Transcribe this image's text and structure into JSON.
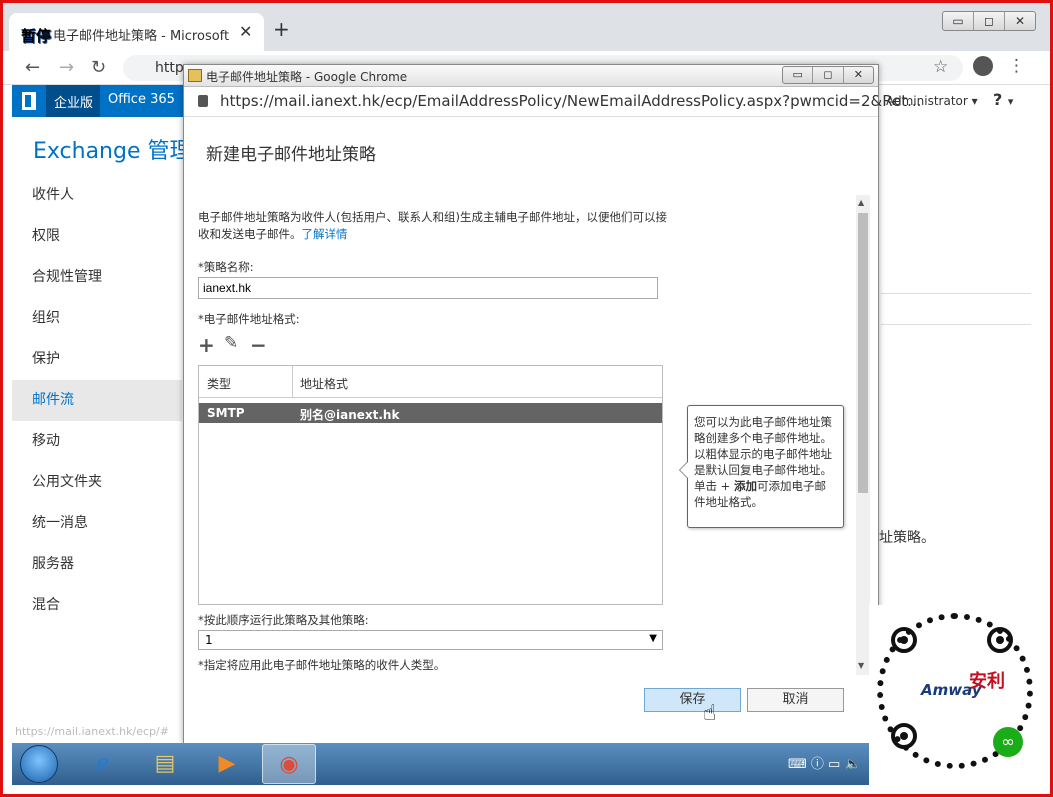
{
  "browser": {
    "tab_overlay": "暂停",
    "tab_title": "电子邮件地址策略 - Microsoft E",
    "tab_close": "✕",
    "new_tab": "+",
    "url_partial": "http",
    "win_buttons": [
      "▭",
      "◻",
      "✕"
    ]
  },
  "officebar": {
    "enterprise": "企业版",
    "office365": "Office 365",
    "user": "Administrator",
    "user_caret": "▾",
    "help": "?",
    "help_caret": "▾"
  },
  "eac": {
    "title_part1": "Exchange",
    "title_part2": "管理中",
    "nav": [
      "收件人",
      "权限",
      "合规性管理",
      "组织",
      "保护",
      "邮件流",
      "移动",
      "公用文件夹",
      "统一消息",
      "服务器",
      "混合"
    ],
    "active_nav": "邮件流",
    "status_url": "https://mail.ianext.hk/ecp/#",
    "right_fragment": "址策略。"
  },
  "dialog": {
    "window_title": "电子邮件地址策略 - Google Chrome",
    "url": "https://mail.ianext.hk/ecp/EmailAddressPolicy/NewEmailAddressPolicy.aspx?pwmcid=2&Ret...",
    "heading": "新建电子邮件地址策略",
    "description": "电子邮件地址策略为收件人(包括用户、联系人和组)生成主辅电子邮件地址，以便他们可以接收和发送电子邮件。",
    "learn_more": "了解详情",
    "policy_name_label": "*策略名称:",
    "policy_name_value": "ianext.hk",
    "formats_label": "*电子邮件地址格式:",
    "toolbar": {
      "add": "+",
      "edit": "✎",
      "remove": "−"
    },
    "grid": {
      "columns": [
        "类型",
        "地址格式"
      ],
      "rows": [
        {
          "type": "SMTP",
          "format": "别名@ianext.hk"
        }
      ]
    },
    "tooltip": {
      "line1": "您可以为此电子邮件地址策略创建多个电子邮件地址。以粗体显示的电子邮件地址是默认回复电子邮件地址。单击 + ",
      "bold": "添加",
      "line2": "可添加电子邮件地址格式。"
    },
    "order_label": "*按此顺序运行此策略及其他策略:",
    "order_value": "1",
    "order_caret": "▼",
    "recipients_label": "*指定将应用此电子邮件地址策略的收件人类型。",
    "save": "保存",
    "cancel": "取消"
  },
  "qr": {
    "logo": "Amway",
    "seal": "安利",
    "mini": "∞"
  }
}
